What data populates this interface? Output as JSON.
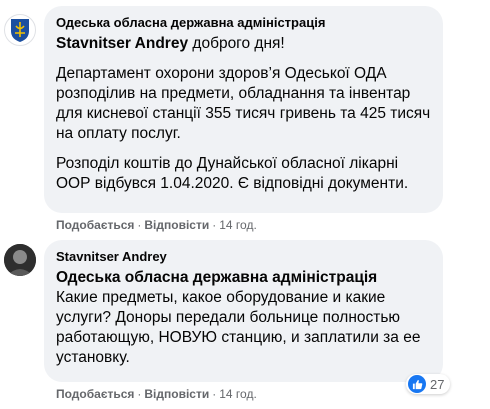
{
  "comments": [
    {
      "author": "Одеська обласна державна адміністрація",
      "mention": "Stavnitser Andrey",
      "greeting": " доброго дня!",
      "paragraph_1": "Департамент охорони здоров’я Одеської ОДА розподілив на предмети, обладнання та інвентар для кисневої станції 355 тисяч гривень та 425 тисяч на оплату послуг.",
      "paragraph_2": "Розподіл коштів до Дунайської обласної лікарні ООР відбувся 1.04.2020. Є відповідні документи.",
      "like_label": "Подобається",
      "reply_label": "Відповісти",
      "time": "14 год."
    },
    {
      "author": "Stavnitser Andrey",
      "mention": "Одеська обласна державна адміністрація",
      "body": "Какие предметы, какое оборудование и какие услуги? Доноры передали больнице полностью работающую, НОВУЮ станцию, и заплатили за ее установку.",
      "like_label": "Подобається",
      "reply_label": "Відповісти",
      "time": "14 год.",
      "reaction_count": "27",
      "reaction_icon": "thumbs-up-icon",
      "reaction_color": "#1877f2"
    }
  ]
}
